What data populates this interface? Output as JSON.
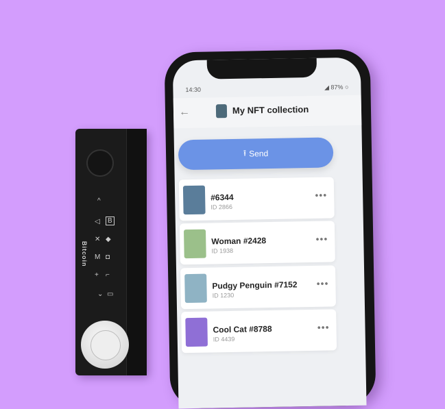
{
  "phone": {
    "time": "14:30",
    "battery": "87%",
    "title": "My NFT collection",
    "send_label": "Send",
    "nfts": [
      {
        "name": "#6344",
        "id": "ID 2866",
        "color": "#5a7d9a"
      },
      {
        "name": "Woman #2428",
        "id": "ID 1938",
        "color": "#9bc08a"
      },
      {
        "name": "Pudgy Penguin #7152",
        "id": "ID 1230",
        "color": "#8fb3c4"
      },
      {
        "name": "Cool Cat #8788",
        "id": "ID 4439",
        "color": "#8f6fd6"
      }
    ]
  },
  "ledger": {
    "coin_label": "Bitcoin"
  },
  "colors": {
    "background": "#d39dfd",
    "accent": "#6b93e6"
  }
}
